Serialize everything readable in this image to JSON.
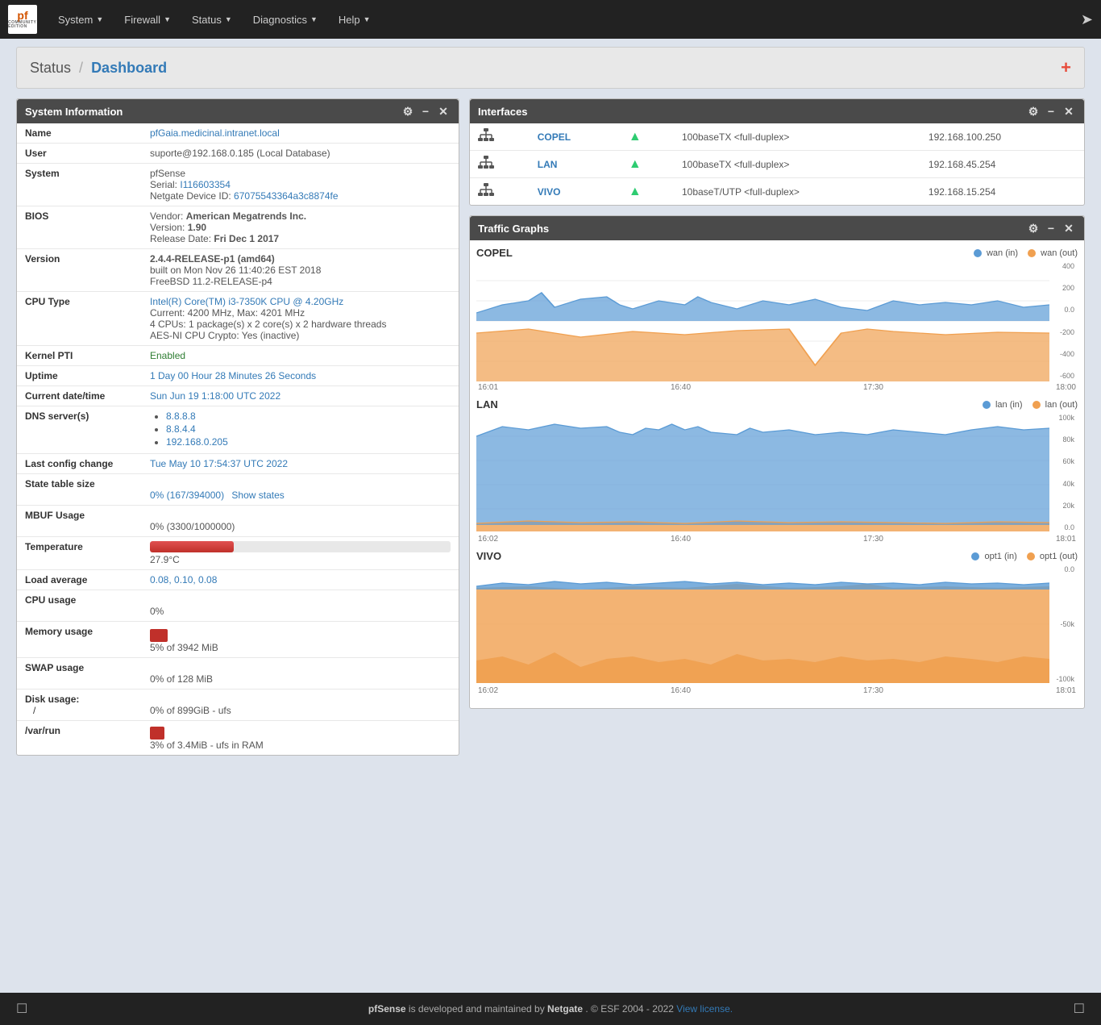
{
  "navbar": {
    "brand": "pfSense",
    "brand_sub": "COMMUNITY EDITION",
    "items": [
      {
        "label": "System",
        "has_dropdown": true
      },
      {
        "label": "Firewall",
        "has_dropdown": true
      },
      {
        "label": "Status",
        "has_dropdown": true
      },
      {
        "label": "Diagnostics",
        "has_dropdown": true
      },
      {
        "label": "Help",
        "has_dropdown": true
      }
    ]
  },
  "breadcrumb": {
    "parent": "Status",
    "current": "Dashboard",
    "separator": "/"
  },
  "sysinfo": {
    "panel_title": "System Information",
    "rows": [
      {
        "label": "Name",
        "value": "pfGaia.medicinal.intranet.local"
      },
      {
        "label": "User",
        "value": "suporte@192.168.0.185 (Local Database)"
      },
      {
        "label": "System",
        "value": "pfSense\nSerial: I116603354\nNetgate Device ID: 67075543364a3c8874fe"
      },
      {
        "label": "BIOS",
        "value": "Vendor: American Megatrends Inc.\nVersion: 1.90\nRelease Date: Fri Dec 1 2017"
      },
      {
        "label": "Version",
        "value": "2.4.4-RELEASE-p1 (amd64)\nbuilt on Mon Nov 26 11:40:26 EST 2018\nFreeBSD 11.2-RELEASE-p4"
      },
      {
        "label": "CPU Type",
        "value": "Intel(R) Core(TM) i3-7350K CPU @ 4.20GHz\nCurrent: 4200 MHz, Max: 4201 MHz\n4 CPUs: 1 package(s) x 2 core(s) x 2 hardware threads\nAES-NI CPU Crypto: Yes (inactive)"
      },
      {
        "label": "Kernel PTI",
        "value": "Enabled"
      },
      {
        "label": "Uptime",
        "value": "1 Day 00 Hour 28 Minutes 26 Seconds"
      },
      {
        "label": "Current date/time",
        "value": "Sun Jun 19 1:18:00 UTC 2022"
      },
      {
        "label": "DNS server(s)",
        "dns": [
          "8.8.8.8",
          "8.8.4.4",
          "192.168.0.205"
        ]
      },
      {
        "label": "Last config change",
        "value": "Tue May 10 17:54:37 UTC 2022"
      },
      {
        "label": "State table size",
        "value": "0% (167/394000)",
        "link": "Show states"
      },
      {
        "label": "MBUF Usage",
        "value": "0% (3300/1000000)"
      },
      {
        "label": "Temperature",
        "bar": true,
        "bar_pct": 28,
        "bar_color": "red",
        "value": "27.9°C"
      },
      {
        "label": "Load average",
        "value": "0.08, 0.10, 0.08"
      },
      {
        "label": "CPU usage",
        "value": "0%"
      },
      {
        "label": "Memory usage",
        "bar": true,
        "bar_pct": 5,
        "bar_color": "red-small",
        "value": "5% of 3942 MiB"
      },
      {
        "label": "SWAP usage",
        "value": "0% of 128 MiB"
      },
      {
        "label": "Disk usage:",
        "sub_rows": [
          {
            "label": "/",
            "value": "0% of 899GiB - ufs"
          },
          {
            "label": "/var/run",
            "bar": true,
            "bar_pct": 3,
            "bar_color": "red-small",
            "value": "3% of 3.4MiB - ufs in RAM"
          }
        ]
      }
    ]
  },
  "interfaces": {
    "panel_title": "Interfaces",
    "rows": [
      {
        "name": "COPEL",
        "status": "up",
        "speed": "100baseTX <full-duplex>",
        "ip": "192.168.100.250"
      },
      {
        "name": "LAN",
        "status": "up",
        "speed": "100baseTX <full-duplex>",
        "ip": "192.168.45.254"
      },
      {
        "name": "VIVO",
        "status": "up",
        "speed": "10baseT/UTP <full-duplex>",
        "ip": "192.168.15.254"
      }
    ]
  },
  "traffic_graphs": {
    "panel_title": "Traffic Graphs",
    "graphs": [
      {
        "title": "COPEL",
        "legend_in": "wan (in)",
        "legend_out": "wan (out)",
        "color_in": "#5b9bd5",
        "color_out": "#f0a050",
        "y_labels": [
          "400",
          "200",
          "0.0",
          "-200",
          "-400",
          "-600"
        ],
        "x_labels": [
          "16:01",
          "16:40",
          "17:30",
          "18:00"
        ]
      },
      {
        "title": "LAN",
        "legend_in": "lan (in)",
        "legend_out": "lan (out)",
        "color_in": "#5b9bd5",
        "color_out": "#f0a050",
        "y_labels": [
          "100k",
          "80k",
          "60k",
          "40k",
          "20k",
          "0.0"
        ],
        "x_labels": [
          "16:02",
          "16:40",
          "17:30",
          "18:01"
        ]
      },
      {
        "title": "VIVO",
        "legend_in": "opt1 (in)",
        "legend_out": "opt1 (out)",
        "color_in": "#5b9bd5",
        "color_out": "#f0a050",
        "y_labels": [
          "0.0",
          "-50k",
          "-100k"
        ],
        "x_labels": [
          "16:02",
          "16:40",
          "17:30",
          "18:01"
        ]
      }
    ]
  },
  "footer": {
    "text_main": "pfSense",
    "text_mid": " is developed and maintained by ",
    "text_netgate": "Netgate",
    "text_copy": ". © ESF 2004 - 2022 ",
    "text_license": "View license."
  }
}
